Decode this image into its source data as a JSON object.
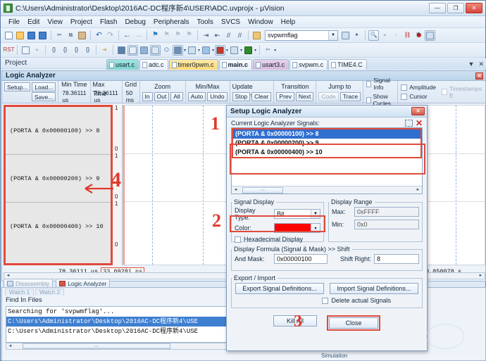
{
  "window": {
    "title": "C:\\Users\\Administrator\\Desktop\\2016AC-DC程序新4\\USER\\ADC.uvprojx - µVision",
    "minimize": "—",
    "maximize": "❐",
    "close": "✕"
  },
  "menu": [
    "File",
    "Edit",
    "View",
    "Project",
    "Flash",
    "Debug",
    "Peripherals",
    "Tools",
    "SVCS",
    "Window",
    "Help"
  ],
  "toolbar": {
    "search_value": "svpwmflag",
    "dropdown_arrow": "▼"
  },
  "project_bar": {
    "title": "Project",
    "pin": "⌷",
    "close": "✕"
  },
  "editor_tabs": [
    {
      "label": "usart.c",
      "state": "active-a"
    },
    {
      "label": "adc.c",
      "state": "normal"
    },
    {
      "label": "timer0pwm.c",
      "state": "active-b"
    },
    {
      "label": "main.c",
      "state": "normal"
    },
    {
      "label": "usart3.c",
      "state": "active-c"
    },
    {
      "label": "svpwm.c",
      "state": "normal"
    },
    {
      "label": "TIME4.C",
      "state": "normal"
    }
  ],
  "tabstrip_right": {
    "list": "▼",
    "close": "✕"
  },
  "logic_analyzer": {
    "title": "Logic Analyzer",
    "close": "✕",
    "groups": {
      "setup": {
        "setup": "Setup...",
        "load": "Load...",
        "save": "Save..."
      },
      "min_time": {
        "header": "Min Time",
        "value": "78.36111 us"
      },
      "max_time": {
        "header": "Max Time",
        "value": "78.36111 us"
      },
      "grid": {
        "header": "Grid",
        "value": "50 ms"
      },
      "zoom": {
        "header": "Zoom",
        "in": "In",
        "out": "Out",
        "all": "All"
      },
      "minmax": {
        "header": "Min/Max",
        "auto": "Auto",
        "undo": "Undo"
      },
      "update_screen": {
        "header": "Update Screen",
        "stop": "Stop",
        "clear": "Clear"
      },
      "transition": {
        "header": "Transition",
        "prev": "Prev",
        "next": "Next"
      },
      "jump_to": {
        "header": "Jump to",
        "code": "Code",
        "trace": "Trace"
      }
    },
    "checkboxes": [
      {
        "label": "Signal Info",
        "checked": false,
        "disabled": false
      },
      {
        "label": "Show Cycles",
        "checked": false,
        "disabled": false
      },
      {
        "label": "Amplitude",
        "checked": false,
        "disabled": false
      },
      {
        "label": "Cursor",
        "checked": false,
        "disabled": false
      },
      {
        "label": "Timestamps E",
        "checked": false,
        "disabled": true
      }
    ],
    "signals": [
      {
        "label": "(PORTA & 0x00000100) >> 8",
        "high": "1",
        "low": "0"
      },
      {
        "label": "(PORTA & 0x00000200) >> 9",
        "high": "1",
        "low": "0"
      },
      {
        "label": "(PORTA & 0x00000400) >> 10",
        "high": "1",
        "low": "0"
      }
    ],
    "footer": {
      "left_time": "78.36111 us",
      "cursor_time": "33.09281 ns",
      "right_time": "0.850078 s"
    }
  },
  "bottom_buttons": [
    {
      "label": "Disassembly",
      "icon": "magnifier-icon",
      "disabled": true
    },
    {
      "label": "Logic Analyzer",
      "icon": "analyzer-icon",
      "disabled": false
    }
  ],
  "watch_tabs": [
    "Watch 1",
    "Watch 2"
  ],
  "find_in_files": {
    "header": "Find In Files",
    "lines": [
      {
        "text": "Searching for 'svpwmflag'...",
        "selected": false
      },
      {
        "text": "C:\\Users\\Administrator\\Desktop\\2016AC-DC程序新4\\USE",
        "selected": true
      },
      {
        "text": "C:\\Users\\Administrator\\Desktop\\2016AC-DC程序新4\\USE",
        "selected": false
      }
    ],
    "scroll_left": "◄",
    "scroll_right": "►",
    "thumb": "⋯"
  },
  "dialog": {
    "title": "Setup Logic Analyzer",
    "close": "✕",
    "signals_label": "Current Logic Analyzer Signals:",
    "signals": [
      {
        "text": "(PORTA & 0x00000100) >> 8",
        "selected": true
      },
      {
        "text": "(PORTA & 0x00000200) >> 9",
        "selected": false
      },
      {
        "text": "(PORTA & 0x00000400) >> 10",
        "selected": false
      }
    ],
    "list_scroll": {
      "left": "◄",
      "right": "►",
      "thumb": "⋯"
    },
    "signal_display": {
      "legend": "Signal Display",
      "display_type_label": "Display Type:",
      "display_type_value": "Bit",
      "color_label": "Color:",
      "color_value": "#FF0000",
      "color_arrow": "▾",
      "hex_label": "Hexadecimal Display",
      "hex_checked": false
    },
    "display_range": {
      "legend": "Display Range",
      "max_label": "Max:",
      "max_value": "0xFFFF",
      "min_label": "Min:",
      "min_value": "0x0"
    },
    "display_formula": {
      "legend": "Display Formula (Signal & Mask) >> Shift",
      "and_mask_label": "And Mask:",
      "and_mask_value": "0x00000100",
      "shift_right_label": "Shift Right:",
      "shift_right_value": "8"
    },
    "export_import": {
      "legend": "Export / Import",
      "export": "Export Signal Definitions...",
      "import": "Import Signal Definitions...",
      "delete_label": "Delete actual Signals",
      "delete_checked": false
    },
    "kill_all": "Kill All",
    "close_button": "Close"
  },
  "annotations": [
    {
      "id": "anno-1",
      "text": "1"
    },
    {
      "id": "anno-2",
      "text": "2"
    },
    {
      "id": "anno-3",
      "text": "3"
    },
    {
      "id": "anno-4",
      "text": "4"
    }
  ],
  "status": {
    "simulation": "Simulation"
  },
  "theme": {
    "accent": "#e04a3c",
    "select_blue": "#2f6fd0",
    "signal_color": "#FF0000"
  }
}
